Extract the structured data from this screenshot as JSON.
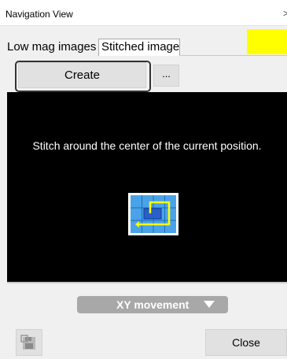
{
  "window": {
    "title": "Navigation View",
    "close_glyph": ">"
  },
  "tabs": [
    {
      "label": "Low mag images",
      "active": false
    },
    {
      "label": "Stitched image",
      "active": true
    }
  ],
  "indicator": {
    "color": "#ffff00"
  },
  "toolbar": {
    "create_label": "Create",
    "more_label": "..."
  },
  "viewer": {
    "message": "Stitch around the center of the current position.",
    "icon": "stitch-around-center-icon"
  },
  "movement": {
    "selected": "XY movement",
    "dropdown_icon": "triangle-down-icon"
  },
  "footer": {
    "save_icon": "save-stitch-icon",
    "close_label": "Close"
  },
  "colors": {
    "window_bg": "#f0f0f0",
    "panel_bg": "#000000",
    "button_bg": "#e1e1e1",
    "dropdown_bg": "#a8a8a8",
    "icon_blue": "#4aa3e8",
    "icon_path": "#ffff00"
  }
}
